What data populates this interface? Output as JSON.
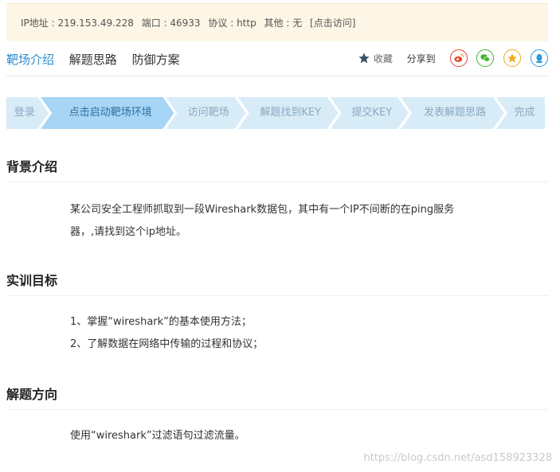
{
  "info": {
    "ip": "IP地址 : 219.153.49.228",
    "port": "端口 : 46933",
    "protocol": "协议 : http",
    "other": "其他 : 无",
    "visit_link": "[点击访问]"
  },
  "tabs": [
    {
      "label": "靶场介绍",
      "active": true
    },
    {
      "label": "解题思路",
      "active": false
    },
    {
      "label": "防御方案",
      "active": false
    }
  ],
  "actions": {
    "favorite_label": "收藏",
    "share_label": "分享到",
    "share_icons": [
      "weibo-icon",
      "wechat-icon",
      "qzone-icon",
      "qq-icon"
    ],
    "colors": {
      "weibo": "#e6452d",
      "wechat": "#49b233",
      "qzone": "#f1a91e",
      "qq": "#2d9ae0"
    }
  },
  "steps": [
    {
      "label": "登录",
      "active": false
    },
    {
      "label": "点击启动靶场环境",
      "active": true
    },
    {
      "label": "访问靶场",
      "active": false
    },
    {
      "label": "解题找到KEY",
      "active": false
    },
    {
      "label": "提交KEY",
      "active": false
    },
    {
      "label": "发表解题思路",
      "active": false
    },
    {
      "label": "完成",
      "active": false
    }
  ],
  "sections": {
    "background": {
      "title": "背景介绍",
      "lines": [
        "某公司安全工程师抓取到一段Wireshark数据包，其中有一个IP不间断的在ping服务",
        "器，,请找到这个ip地址。"
      ]
    },
    "goals": {
      "title": "实训目标",
      "lines": [
        "1、掌握“wireshark”的基本使用方法；",
        "2、了解数据在网络中传输的过程和协议；"
      ]
    },
    "direction": {
      "title": "解题方向",
      "lines": [
        "使用“wireshark”过滤语句过滤流量。"
      ]
    }
  },
  "watermark": "https://blog.csdn.net/asd158923328"
}
